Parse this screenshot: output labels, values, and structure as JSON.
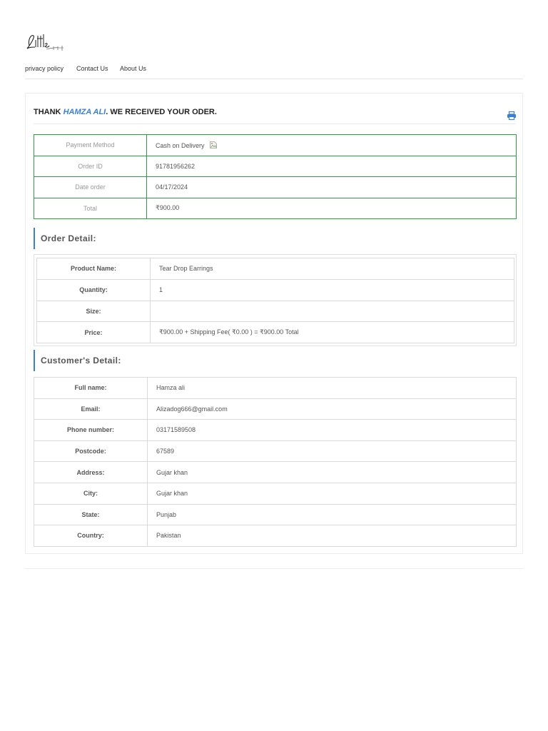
{
  "nav": {
    "privacy": "privacy policy",
    "contact": "Contact Us",
    "about": "About Us"
  },
  "thanks": {
    "prefix": "THANK ",
    "name": "HAMZA ALI",
    "suffix": ". WE RECEIVED YOUR ODER."
  },
  "payment": {
    "method_label": "Payment Method",
    "method_value": "Cash on Delivery",
    "order_id_label": "Order ID",
    "order_id_value": "91781956262",
    "date_label": "Date order",
    "date_value": "04/17/2024",
    "total_label": "Total",
    "total_value": "₹900.00"
  },
  "order_detail": {
    "title": "Order Detail:",
    "rows": [
      {
        "label": "Product Name:",
        "value": "Tear Drop Earrings"
      },
      {
        "label": "Quantity:",
        "value": "1"
      },
      {
        "label": "Size:",
        "value": ""
      },
      {
        "label": "Price:",
        "value": "₹900.00 + Shipping Fee( ₹0.00 ) = ₹900.00 Total"
      }
    ]
  },
  "customer_detail": {
    "title": "Customer's Detail:",
    "rows": [
      {
        "label": "Full name:",
        "value": "Hamza ali"
      },
      {
        "label": "Email:",
        "value": "Alizadog666@gmail.com"
      },
      {
        "label": "Phone number:",
        "value": "03171589508"
      },
      {
        "label": "Postcode:",
        "value": "67589"
      },
      {
        "label": "Address:",
        "value": "Gujar khan"
      },
      {
        "label": "City:",
        "value": "Gujar khan"
      },
      {
        "label": "State:",
        "value": "Punjab"
      },
      {
        "label": "Country:",
        "value": "Pakistan"
      }
    ]
  },
  "colors": {
    "accent": "#3a7fd5",
    "payment_border": "#2e9d44"
  },
  "icons": {
    "print": "print-icon",
    "broken_image": "broken-image-icon",
    "logo": "little-logo"
  }
}
